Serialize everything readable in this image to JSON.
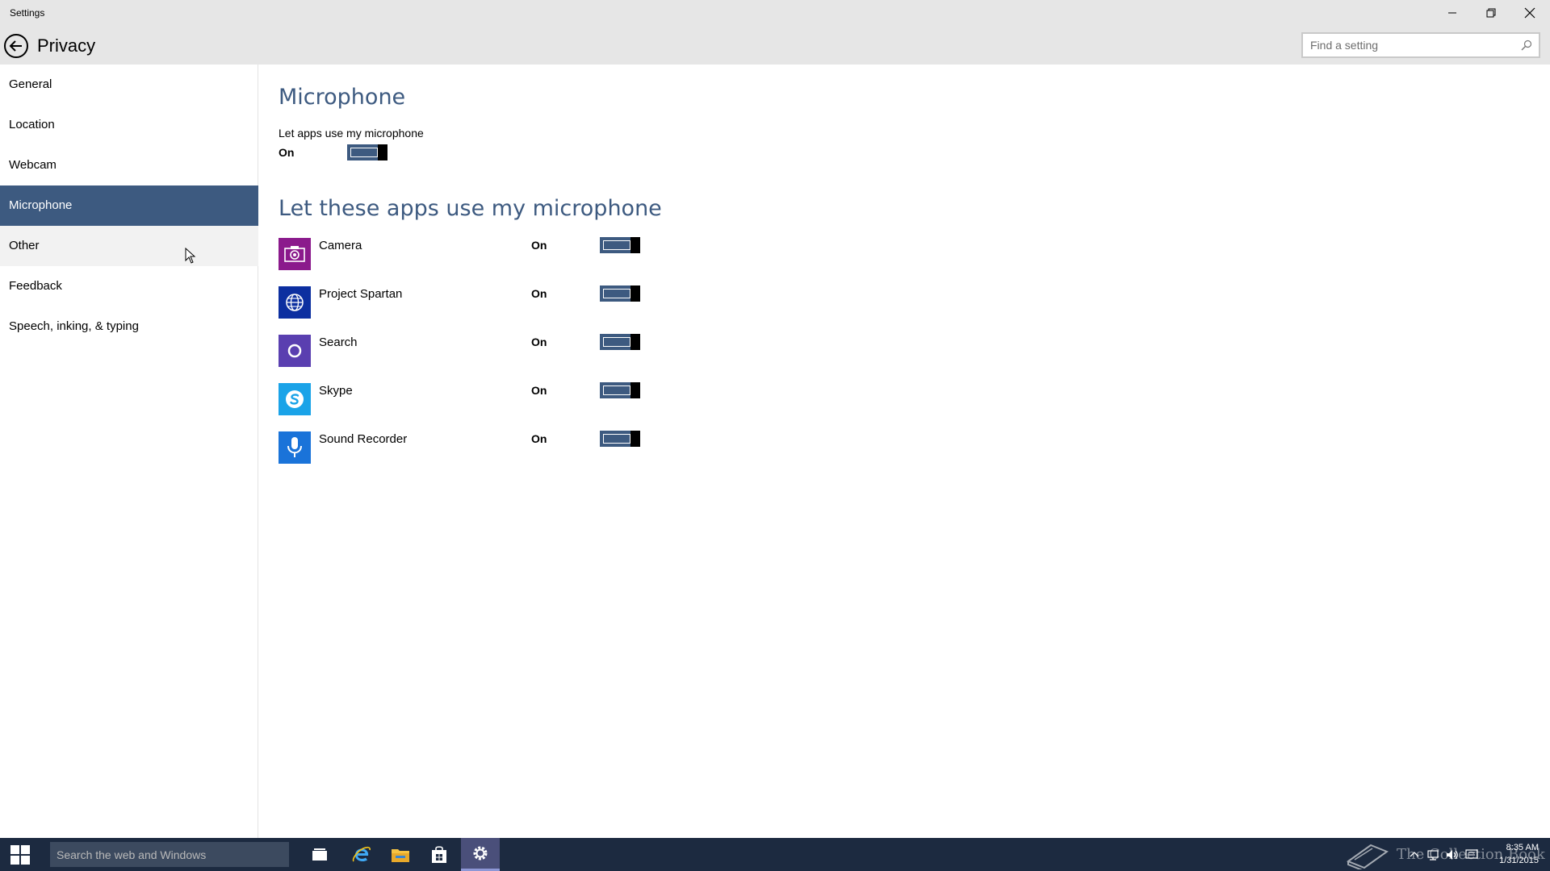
{
  "window": {
    "title": "Settings",
    "minimize_icon": "minimize-icon",
    "restore_icon": "restore-icon",
    "close_icon": "close-icon"
  },
  "header": {
    "title": "Privacy",
    "back_icon": "back-arrow-icon",
    "search": {
      "placeholder": "Find a setting",
      "value": "",
      "icon": "search-icon"
    }
  },
  "sidebar": {
    "items": [
      {
        "label": "General"
      },
      {
        "label": "Location"
      },
      {
        "label": "Webcam"
      },
      {
        "label": "Microphone",
        "selected": true
      },
      {
        "label": "Other",
        "hovered": true
      },
      {
        "label": "Feedback"
      },
      {
        "label": "Speech, inking, & typing"
      }
    ]
  },
  "main": {
    "heading": "Microphone",
    "master_toggle": {
      "label": "Let apps use my microphone",
      "state": "On"
    },
    "apps_heading": "Let these apps use my microphone",
    "apps": [
      {
        "name": "Camera",
        "state": "On",
        "icon": "camera-icon",
        "color": "#8b1a8c"
      },
      {
        "name": "Project Spartan",
        "state": "On",
        "icon": "globe-icon",
        "color": "#0c2fa0"
      },
      {
        "name": "Search",
        "state": "On",
        "icon": "cortana-circle-icon",
        "color": "#5a3fb0"
      },
      {
        "name": "Skype",
        "state": "On",
        "icon": "skype-icon",
        "color": "#1aa3e8"
      },
      {
        "name": "Sound Recorder",
        "state": "On",
        "icon": "microphone-icon",
        "color": "#1a73d9"
      }
    ]
  },
  "taskbar": {
    "search_placeholder": "Search the web and Windows",
    "apps": [
      "task-view-icon",
      "internet-explorer-icon",
      "file-explorer-icon",
      "store-icon",
      "settings-icon"
    ],
    "active_app": "settings-icon",
    "tray_icons": [
      "chevron-up-icon",
      "network-icon",
      "volume-icon",
      "action-center-icon"
    ],
    "time": "8:35 AM",
    "date": "1/31/2015"
  },
  "watermark": {
    "text": "The Collection Book"
  },
  "colors": {
    "accent": "#3d5a80",
    "titlebar": "#e6e6e6",
    "taskbar": "#1c2a40"
  }
}
